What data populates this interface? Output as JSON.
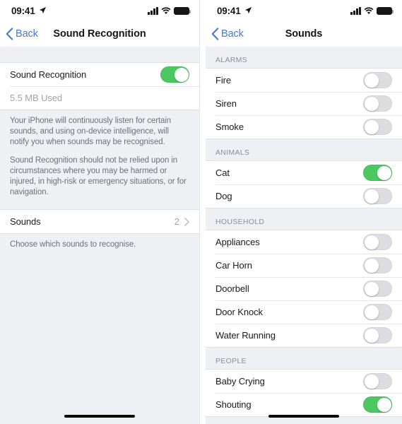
{
  "status_bar": {
    "time": "09:41",
    "location_icon": "location-arrow-icon",
    "cellular_icon": "cellular-signal-icon",
    "wifi_icon": "wifi-icon",
    "battery_icon": "battery-full-icon"
  },
  "colors": {
    "toggle_on": "#4cc863",
    "toggle_off": "#dcdce1",
    "tint_blue": "#4a79c9",
    "group_background": "#eff0f4",
    "row_background": "#ffffff",
    "primary_text": "#1b1b1f",
    "secondary_text": "#8c8c94"
  },
  "left_screen": {
    "nav": {
      "back_label": "Back",
      "title": "Sound Recognition"
    },
    "main_toggle": {
      "label": "Sound Recognition",
      "state": "on"
    },
    "usage": {
      "label": "5.5 MB Used"
    },
    "footer_paragraphs": [
      "Your iPhone will continuously listen for certain sounds, and using on-device intelligence, will notify you when sounds may be recognised.",
      "Sound Recognition should not be relied upon in circumstances where you may be harmed or injured, in high-risk or emergency situations, or for navigation."
    ],
    "sounds_row": {
      "label": "Sounds",
      "value": "2",
      "disclosure_icon": "chevron-right-icon"
    },
    "sounds_footer": "Choose which sounds to recognise."
  },
  "right_screen": {
    "nav": {
      "back_label": "Back",
      "title": "Sounds"
    },
    "sections": [
      {
        "header": "ALARMS",
        "items": [
          {
            "label": "Fire",
            "state": "off"
          },
          {
            "label": "Siren",
            "state": "off"
          },
          {
            "label": "Smoke",
            "state": "off"
          }
        ]
      },
      {
        "header": "ANIMALS",
        "items": [
          {
            "label": "Cat",
            "state": "on"
          },
          {
            "label": "Dog",
            "state": "off"
          }
        ]
      },
      {
        "header": "HOUSEHOLD",
        "items": [
          {
            "label": "Appliances",
            "state": "off"
          },
          {
            "label": "Car Horn",
            "state": "off"
          },
          {
            "label": "Doorbell",
            "state": "off"
          },
          {
            "label": "Door Knock",
            "state": "off"
          },
          {
            "label": "Water Running",
            "state": "off"
          }
        ]
      },
      {
        "header": "PEOPLE",
        "items": [
          {
            "label": "Baby Crying",
            "state": "off"
          },
          {
            "label": "Shouting",
            "state": "on"
          }
        ]
      }
    ]
  }
}
